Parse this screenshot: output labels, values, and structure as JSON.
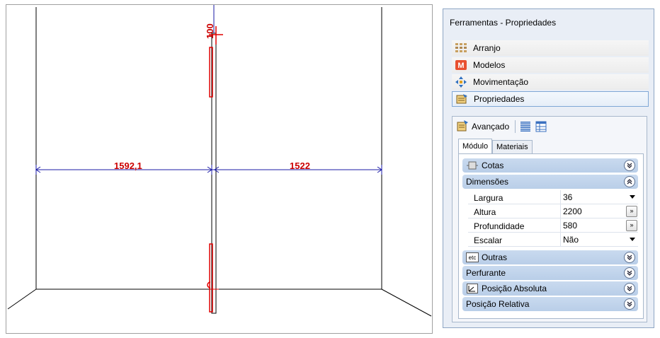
{
  "viewport": {
    "dim_left": "1592,1",
    "dim_right": "1522",
    "dim_top": "100",
    "colors": {
      "wall_line": "#000000",
      "object": "#e00000",
      "dimension": "#1a1aa6",
      "dimension_text": "#cc0000"
    }
  },
  "panel": {
    "title": "Ferramentas - Propriedades",
    "categories": [
      {
        "label": "Arranjo",
        "icon": "arrangement-icon"
      },
      {
        "label": "Modelos",
        "icon": "models-icon"
      },
      {
        "label": "Movimentação",
        "icon": "move-icon"
      },
      {
        "label": "Propriedades",
        "icon": "properties-icon"
      }
    ],
    "toolbar": {
      "advanced_label": "Avançado",
      "icons": [
        "categorized-view-icon",
        "table-view-icon"
      ]
    },
    "tabs": [
      {
        "label": "Módulo",
        "active": true
      },
      {
        "label": "Materiais",
        "active": false
      }
    ],
    "sections": {
      "cotas": {
        "label": "Cotas",
        "state": "collapsed"
      },
      "dimensoes": {
        "label": "Dimensões",
        "state": "expanded"
      },
      "outras": {
        "label": "Outras",
        "state": "collapsed"
      },
      "perfurante": {
        "label": "Perfurante",
        "state": "collapsed"
      },
      "posicao_absoluta": {
        "label": "Posição Absoluta",
        "state": "collapsed"
      },
      "posicao_relativa": {
        "label": "Posição Relativa",
        "state": "collapsed"
      }
    },
    "dimension_props": {
      "largura": {
        "name": "Largura",
        "value": "36"
      },
      "altura": {
        "name": "Altura",
        "value": "2200"
      },
      "profundidade": {
        "name": "Profundidade",
        "value": "580"
      },
      "escalar": {
        "name": "Escalar",
        "value": "Não"
      }
    },
    "colors": {
      "section_bg": "#c0d4ec",
      "selected_border": "#7fa7d6"
    }
  }
}
